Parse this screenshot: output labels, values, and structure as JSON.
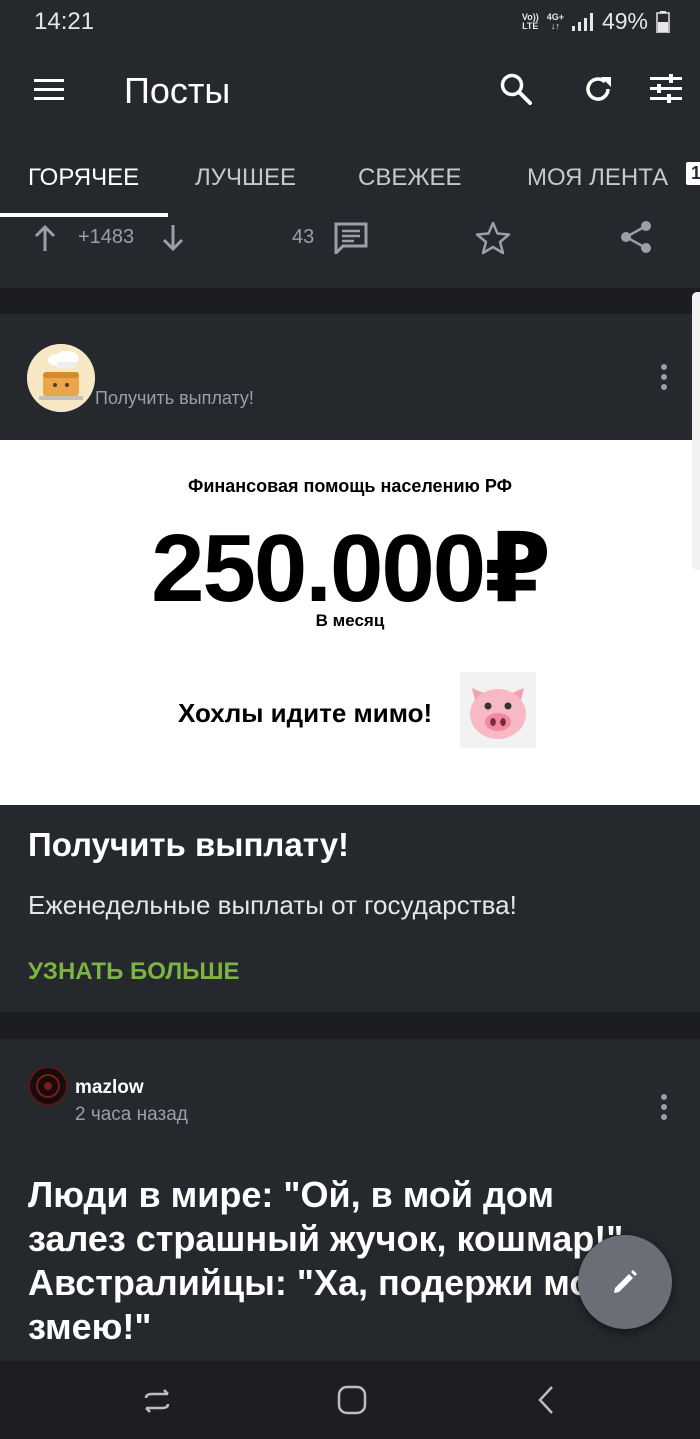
{
  "status_bar": {
    "time": "14:21",
    "volte": [
      "Vo))",
      "LTE"
    ],
    "network": [
      "4G+",
      "↓↑"
    ],
    "battery_percent": "49%"
  },
  "app_bar": {
    "title": "Посты"
  },
  "tabs": [
    {
      "label": "ГОРЯЧЕЕ",
      "active": true
    },
    {
      "label": "ЛУЧШЕЕ",
      "active": false
    },
    {
      "label": "СВЕЖЕЕ",
      "active": false
    },
    {
      "label": "МОЯ ЛЕНТА",
      "active": false,
      "badge": "1"
    }
  ],
  "previous_post": {
    "rating": "+1483",
    "comments": "43"
  },
  "ad_card": {
    "source": "Получить выплату!",
    "image": {
      "subtitle": "Финансовая помощь населению РФ",
      "amount": "250.000₽",
      "period": "В месяц",
      "slogan": "Хохлы идите мимо!"
    },
    "title": "Получить выплату!",
    "description": "Еженедельные выплаты от государства!",
    "link": "УЗНАТЬ БОЛЬШЕ"
  },
  "post_card": {
    "author": "mazlow",
    "time": "2 часа назад",
    "title_lines": [
      "Люди в мире: \"Ой, в мой дом",
      "залез страшный жучок, кошмар!\"",
      "Австралийцы: \"Ха, подержи мою",
      "змею!\""
    ]
  },
  "colors": {
    "background": "#1b1d21",
    "card": "#25282d",
    "accent_link": "#7cb342",
    "fab": "#6a6f77"
  }
}
